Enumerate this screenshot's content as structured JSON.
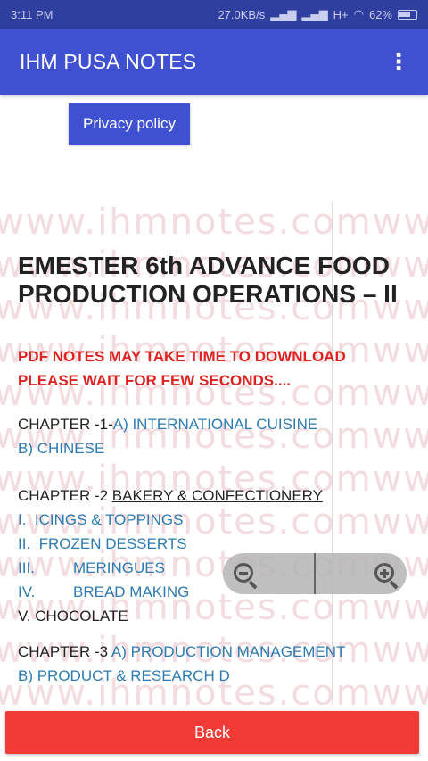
{
  "status_bar": {
    "time": "3:11 PM",
    "network_speed": "27.0KB/s",
    "network_type": "H+",
    "battery": "62%"
  },
  "app_bar": {
    "title": "IHM PUSA NOTES",
    "menu_icon": "more-vert-icon"
  },
  "privacy_button": "Privacy policy",
  "web": {
    "watermark": "www.ihmnotes.comwww.",
    "heading": "EMESTER 6th ADVANCE FOOD PRODUCTION OPERATIONS – II",
    "warning": "PDF NOTES MAY TAKE TIME TO DOWNLOAD PLEASE WAIT FOR FEW SECONDS....",
    "chapter1_label": "CHAPTER -1-",
    "chapter1_a": "A) INTERNATIONAL CUISINE",
    "chapter1_b": "B) CHINESE",
    "chapter2_label": "CHAPTER -2 ",
    "chapter2_title": "BAKERY & CONFECTIONERY",
    "chapter2_items": [
      {
        "num": "I.",
        "text": "ICINGS & TOPPINGS"
      },
      {
        "num": "II.",
        "text": "FROZEN DESSERTS"
      },
      {
        "num": "III.",
        "text": "MERINGUES"
      },
      {
        "num": "IV.",
        "text": "BREAD MAKING"
      }
    ],
    "chapter2_v": "V. CHOCOLATE",
    "chapter3_label": "CHAPTER -3 ",
    "chapter3_a": "A) PRODUCTION MANAGEMENT",
    "chapter3_b": "B) PRODUCT & RESEARCH D"
  },
  "zoom": {
    "out_icon": "zoom-out-icon",
    "in_icon": "zoom-in-icon"
  },
  "back_button": "Back",
  "colors": {
    "primary": "#3f51d0",
    "accent_red": "#f23a37",
    "link_blue": "#2d7bb0",
    "warning_red": "#dd2222"
  }
}
